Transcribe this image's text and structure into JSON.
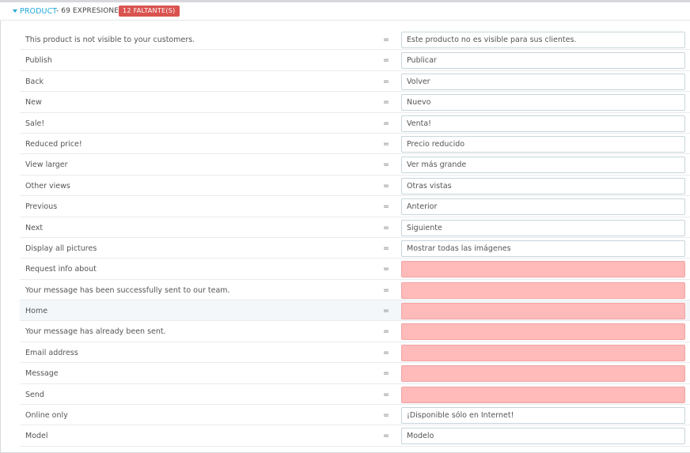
{
  "section": {
    "title": "PRODUCT",
    "count_text": "- 69 EXPRESIONES",
    "missing_badge": "12 FALTANTE(S)",
    "accent_color": "#1fa9d6",
    "missing_color": "#ffbaba"
  },
  "rows": [
    {
      "source": "This product is not visible to your customers.",
      "translation": "Este producto no es visible para sus clientes."
    },
    {
      "source": "Publish",
      "translation": "Publicar"
    },
    {
      "source": "Back",
      "translation": "Volver"
    },
    {
      "source": "New",
      "translation": "Nuevo"
    },
    {
      "source": "Sale!",
      "translation": "Venta!"
    },
    {
      "source": "Reduced price!",
      "translation": "Precio reducido"
    },
    {
      "source": "View larger",
      "translation": "Ver más grande"
    },
    {
      "source": "Other views",
      "translation": "Otras vistas"
    },
    {
      "source": "Previous",
      "translation": "Anterior"
    },
    {
      "source": "Next",
      "translation": "Siguiente"
    },
    {
      "source": "Display all pictures",
      "translation": "Mostrar todas las imágenes"
    },
    {
      "source": "Request info about",
      "translation": ""
    },
    {
      "source": "Your message has been successfully sent to our team.",
      "translation": ""
    },
    {
      "source": "Home",
      "translation": ""
    },
    {
      "source": "Your message has already been sent.",
      "translation": ""
    },
    {
      "source": "Email address",
      "translation": ""
    },
    {
      "source": "Message",
      "translation": ""
    },
    {
      "source": "Send",
      "translation": ""
    },
    {
      "source": "Online only",
      "translation": "¡Disponible sólo en Internet!"
    },
    {
      "source": "Model",
      "translation": "Modelo"
    }
  ],
  "equals_sign": "="
}
